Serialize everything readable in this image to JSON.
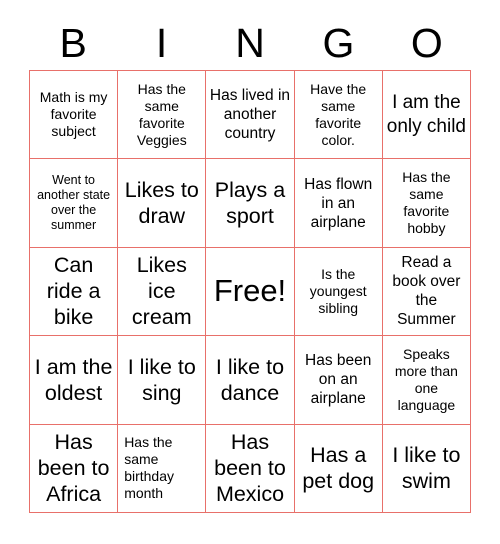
{
  "card": {
    "title_letters": [
      "B",
      "I",
      "N",
      "G",
      "O"
    ],
    "grid_border_color": "#e8706a",
    "text_color": "#000000",
    "background_color": "#ffffff",
    "columns": 5,
    "rows": 5
  },
  "cells": [
    {
      "text": "Math is my favorite subject",
      "size": "sm",
      "align": "center"
    },
    {
      "text": "Has the same favorite Veggies",
      "size": "sm",
      "align": "center"
    },
    {
      "text": "Has lived in another country",
      "size": "md",
      "align": "center"
    },
    {
      "text": "Have the same favorite color.",
      "size": "sm",
      "align": "center"
    },
    {
      "text": "I am the only child",
      "size": "lg",
      "align": "center"
    },
    {
      "text": "Went to another state over the summer",
      "size": "xs",
      "align": "center"
    },
    {
      "text": "Likes to draw",
      "size": "xl",
      "align": "center"
    },
    {
      "text": "Plays a sport",
      "size": "xl",
      "align": "center"
    },
    {
      "text": "Has flown in an airplane",
      "size": "md",
      "align": "center"
    },
    {
      "text": "Has the same favorite hobby",
      "size": "sm",
      "align": "center"
    },
    {
      "text": "Can ride a bike",
      "size": "xl",
      "align": "center"
    },
    {
      "text": "Likes ice cream",
      "size": "xl",
      "align": "center"
    },
    {
      "text": "Free!",
      "size": "free",
      "align": "center"
    },
    {
      "text": "Is the youngest sibling",
      "size": "sm",
      "align": "center"
    },
    {
      "text": "Read a book over the Summer",
      "size": "md",
      "align": "center"
    },
    {
      "text": "I am the oldest",
      "size": "xl",
      "align": "center"
    },
    {
      "text": "I like to sing",
      "size": "xl",
      "align": "center"
    },
    {
      "text": "I like to dance",
      "size": "xl",
      "align": "center"
    },
    {
      "text": "Has been on an airplane",
      "size": "md",
      "align": "center"
    },
    {
      "text": "Speaks more than one language",
      "size": "sm",
      "align": "center"
    },
    {
      "text": "Has been to Africa",
      "size": "xl",
      "align": "center"
    },
    {
      "text": "Has the same birthday month",
      "size": "sm",
      "align": "left"
    },
    {
      "text": "Has been to Mexico",
      "size": "xl",
      "align": "center"
    },
    {
      "text": "Has a pet dog",
      "size": "xl",
      "align": "center"
    },
    {
      "text": "I like to swim",
      "size": "xl",
      "align": "center"
    }
  ]
}
